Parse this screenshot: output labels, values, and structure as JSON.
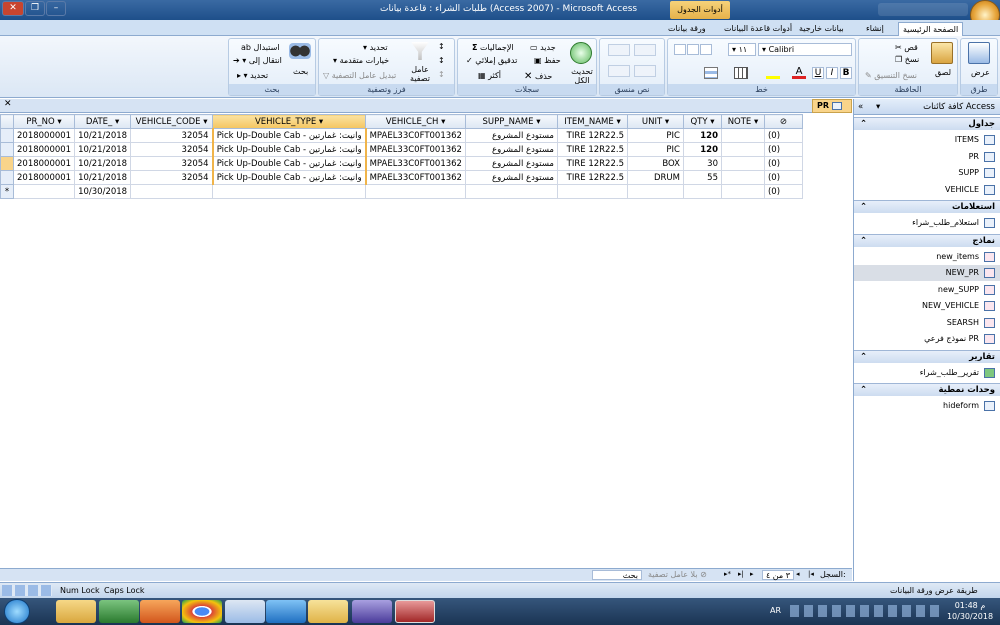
{
  "window": {
    "title": "طلبات الشراء : قاعدة بيانات (Access 2007) - Microsoft Access",
    "context_tools": "أدوات الجدول",
    "office_button": "office-button"
  },
  "ribbon_tabs": [
    "الصفحة الرئيسية",
    "إنشاء",
    "بيانات خارجية",
    "أدوات قاعدة البيانات",
    "ورقة بيانات"
  ],
  "ribbon": {
    "views": {
      "label": "عرض",
      "group": "طرق عرض"
    },
    "clipboard": {
      "paste": "لصق",
      "cut": "قص",
      "copy": "نسخ",
      "format_painter": "نسخ التنسيق",
      "group": "الحافظة"
    },
    "font": {
      "font_name": "Calibri",
      "font_size": "١١",
      "bold": "B",
      "italic": "I",
      "underline": "U",
      "font_color": "A",
      "group": "خط"
    },
    "rich_text": {
      "group": "نص منسق"
    },
    "records": {
      "refresh": "تحديث الكل",
      "new": "جديد",
      "save": "حفظ",
      "delete": "حذف",
      "totals": "الإجماليات",
      "spelling": "تدقيق إملائي",
      "more": "أكثر",
      "group": "سجلات"
    },
    "sort_filter": {
      "filter": "عامل تصفية",
      "selection": "تحديد",
      "advanced": "خيارات متقدمة",
      "toggle_filter": "تبديل عامل التصفية",
      "group": "فرز وتصفية"
    },
    "find": {
      "find": "بحث",
      "replace": "استبدال",
      "goto": "انتقال إلى",
      "select": "تحديد",
      "group": "بحث"
    }
  },
  "doc_tab": "PR",
  "datasheet": {
    "columns": [
      "PR_NO",
      "DATE_",
      "VEHICLE_CODE",
      "VEHICLE_TYPE",
      "VEHICLE_CH",
      "SUPP_NAME",
      "ITEM_NAME",
      "UNIT",
      "QTY",
      "NOTE",
      "@"
    ],
    "rows": [
      [
        "2018000001",
        "10/21/2018",
        "32054",
        "Pick Up-Double Cab - وانيت: غمارتين",
        "MPAEL33C0FT001362",
        "مستودع المشروع",
        "TIRE 12R22.5",
        "PIC",
        "120",
        "",
        "(0)"
      ],
      [
        "2018000001",
        "10/21/2018",
        "32054",
        "Pick Up-Double Cab - وانيت: غمارتين",
        "MPAEL33C0FT001362",
        "مستودع المشروع",
        "TIRE 12R22.5",
        "PIC",
        "120",
        "",
        "(0)"
      ],
      [
        "2018000001",
        "10/21/2018",
        "32054",
        "Pick Up-Double Cab - وانيت: غمارتين",
        "MPAEL33C0FT001362",
        "مستودع المشروع",
        "TIRE 12R22.5",
        "BOX",
        "30",
        "",
        "(0)"
      ],
      [
        "2018000001",
        "10/21/2018",
        "32054",
        "Pick Up-Double Cab - وانيت: غمارتين",
        "MPAEL33C0FT001362",
        "مستودع المشروع",
        "TIRE 12R22.5",
        "DRUM",
        "55",
        "",
        "(0)"
      ]
    ],
    "new_row": {
      "date": "10/30/2018",
      "attach": "(0)",
      "marker": "*"
    }
  },
  "nav_pane": {
    "title": "كافة كائنات Access",
    "sections": [
      {
        "name": "جداول",
        "items": [
          "ITEMS",
          "PR",
          "SUPP",
          "VEHICLE"
        ]
      },
      {
        "name": "استعلامات",
        "items": [
          "استعلام_طلب_شراء"
        ]
      },
      {
        "name": "نماذج",
        "items": [
          "new_items",
          "NEW_PR",
          "new_SUPP",
          "NEW_VEHICLE",
          "SEARSH",
          "نموذج فرعي PR"
        ]
      },
      {
        "name": "تقارير",
        "items": [
          "تقرير_طلب_شراء"
        ]
      },
      {
        "name": "وحدات نمطية",
        "items": [
          "hideform"
        ]
      }
    ]
  },
  "record_nav": {
    "label": "السجل:",
    "position": "٣ من ٤",
    "filter": "بلا عامل تصفية",
    "search": "بحث"
  },
  "status": {
    "view": "طريقة عرض ورقة البيانات",
    "num_lock": "Num Lock",
    "caps_lock": "Caps Lock"
  },
  "taskbar": {
    "lang": "AR",
    "time": "01:48 م",
    "date": "10/30/2018"
  }
}
